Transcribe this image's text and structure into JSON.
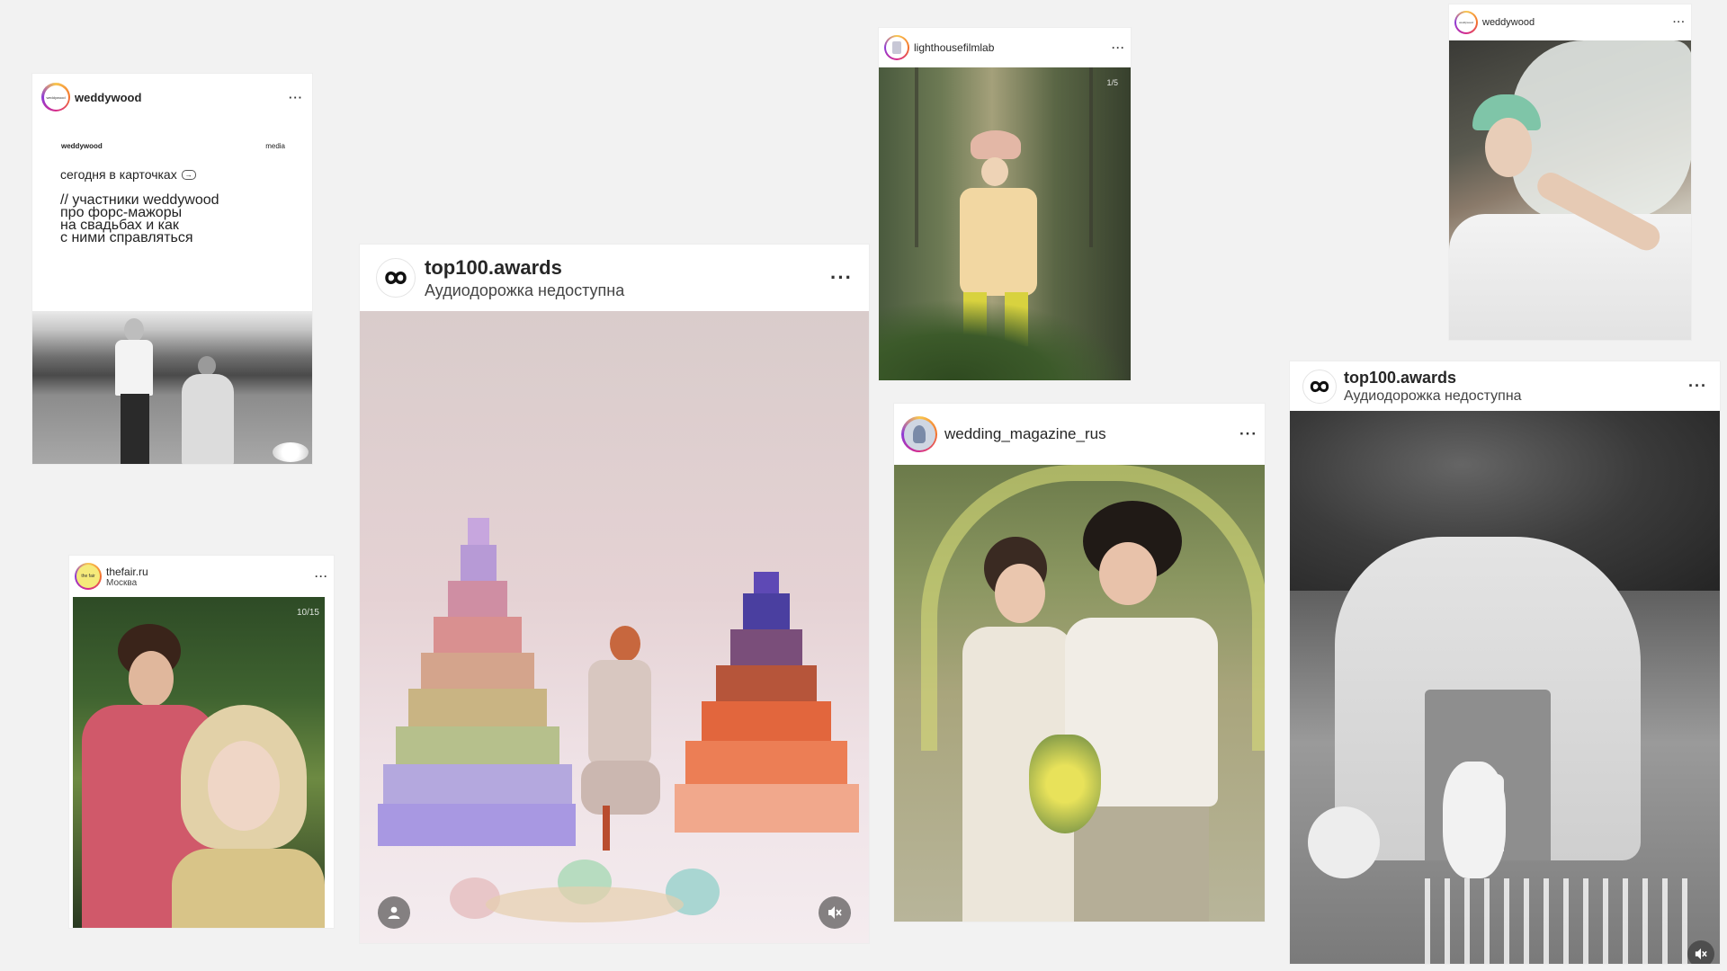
{
  "posts": {
    "weddywood_card": {
      "username": "weddywood",
      "avatar_text": "weddywood",
      "card_brand": "weddywood",
      "card_tag": "media",
      "card_line1": "сегодня в карточках",
      "card_line2": "// участники weddywood",
      "card_line3": "про форс-мажоры",
      "card_line4": "на свадьбах и как",
      "card_line5": "с ними справляться"
    },
    "top100_pyramids": {
      "username": "top100.awards",
      "subtitle": "Аудиодорожка недоступна"
    },
    "lighthouse": {
      "username": "lighthousefilmlab",
      "counter": "1/5"
    },
    "weddywood_veil": {
      "username": "weddywood"
    },
    "thefair": {
      "username": "thefair.ru",
      "location": "Москва",
      "avatar_text": "the fair",
      "counter": "10/15"
    },
    "wedding_magazine": {
      "username": "wedding_magazine_rus"
    },
    "top100_ceremony": {
      "username": "top100.awards",
      "subtitle": "Аудиодорожка недоступна"
    }
  },
  "icons": {
    "more": "more-dots-icon",
    "user": "user-tag-icon",
    "mute": "mute-icon"
  },
  "colors": {
    "background": "#f2f2f2",
    "text": "#262626"
  }
}
